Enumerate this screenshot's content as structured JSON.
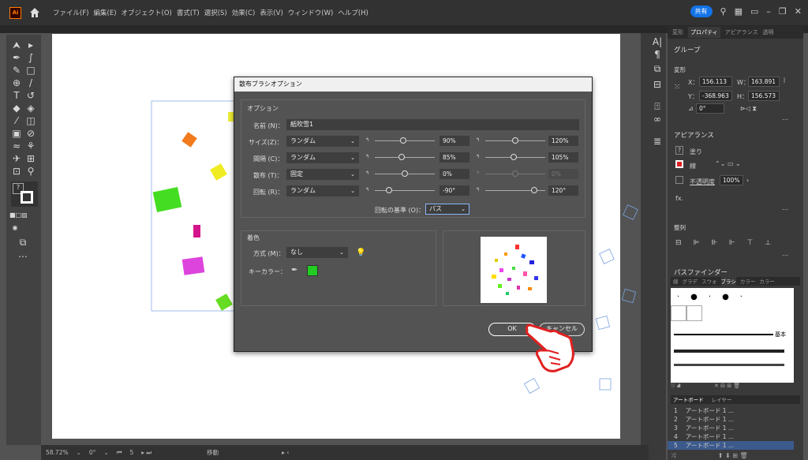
{
  "app": {
    "logo": "Ai",
    "menus": [
      "ファイル(F)",
      "編集(E)",
      "オブジェクト(O)",
      "書式(T)",
      "選択(S)",
      "効果(C)",
      "表示(V)",
      "ウィンドウ(W)",
      "ヘルプ(H)"
    ],
    "share_label": "共有"
  },
  "status": {
    "zoom": "58.72%",
    "rotation": "0°",
    "artboard_num": "5",
    "mode": "移動"
  },
  "dialog": {
    "title": "散布ブラシオプション",
    "options_heading": "オプション",
    "name_label": "名前 (N)：",
    "name_value": "紙吹雪1",
    "size_label": "サイズ(Z)：",
    "size_mode": "ランダム",
    "size_min": "90%",
    "size_max": "120%",
    "spacing_label": "間隔 (C)：",
    "spacing_mode": "ランダム",
    "spacing_min": "85%",
    "spacing_max": "105%",
    "scatter_label": "散布 (T)：",
    "scatter_mode": "固定",
    "scatter_min": "0%",
    "scatter_max": "0%",
    "rotation_label": "回転 (R)：",
    "rotation_mode": "ランダム",
    "rotation_min": "-90°",
    "rotation_max": "120°",
    "rotation_base_label": "回転の基準 (O)：",
    "rotation_base_value": "パス",
    "color_heading": "着色",
    "method_label": "方式 (M)：",
    "method_value": "なし",
    "keycolor_label": "キーカラー：",
    "keycolor": "#22cc22",
    "ok_label": "OK",
    "cancel_label": "キャンセル"
  },
  "panel": {
    "tabs": [
      "変形",
      "プロパティ",
      "アピアランス",
      "透明"
    ],
    "group_label": "グループ",
    "transform_label": "変形",
    "x_label": "X：",
    "x_value": "156.113",
    "w_label": "W：",
    "w_value": "163.891",
    "y_label": "Y：",
    "y_value": "-368.963",
    "h_label": "H：",
    "h_value": "156.573",
    "angle_value": "0°",
    "appearance_label": "アピアランス",
    "fill_label": "塗り",
    "stroke_label": "線",
    "opacity_label": "不透明度",
    "opacity_value": "100%",
    "fx_label": "fx.",
    "align_label": "整列",
    "pathfinder_label": "パスファインダー",
    "lib_tabs": [
      "線",
      "グラデ",
      "スウォ",
      "ブラシ",
      "カラー",
      "カラー"
    ],
    "brush_basic": "基本",
    "artboard_tabs": [
      "アートボード",
      "レイヤー"
    ],
    "artboards": [
      {
        "num": "1",
        "name": "アートボード 1 ..."
      },
      {
        "num": "2",
        "name": "アートボード 1 ..."
      },
      {
        "num": "3",
        "name": "アートボード 1 ..."
      },
      {
        "num": "4",
        "name": "アートボード 1 ..."
      },
      {
        "num": "5",
        "name": "アートボード 1 ..."
      }
    ]
  },
  "colors": {
    "accent": "#1473e6",
    "confetti": [
      "#f07a1c",
      "#f0ec24",
      "#44dd22",
      "#d4148c",
      "#dd44dd",
      "#66dd22"
    ]
  }
}
